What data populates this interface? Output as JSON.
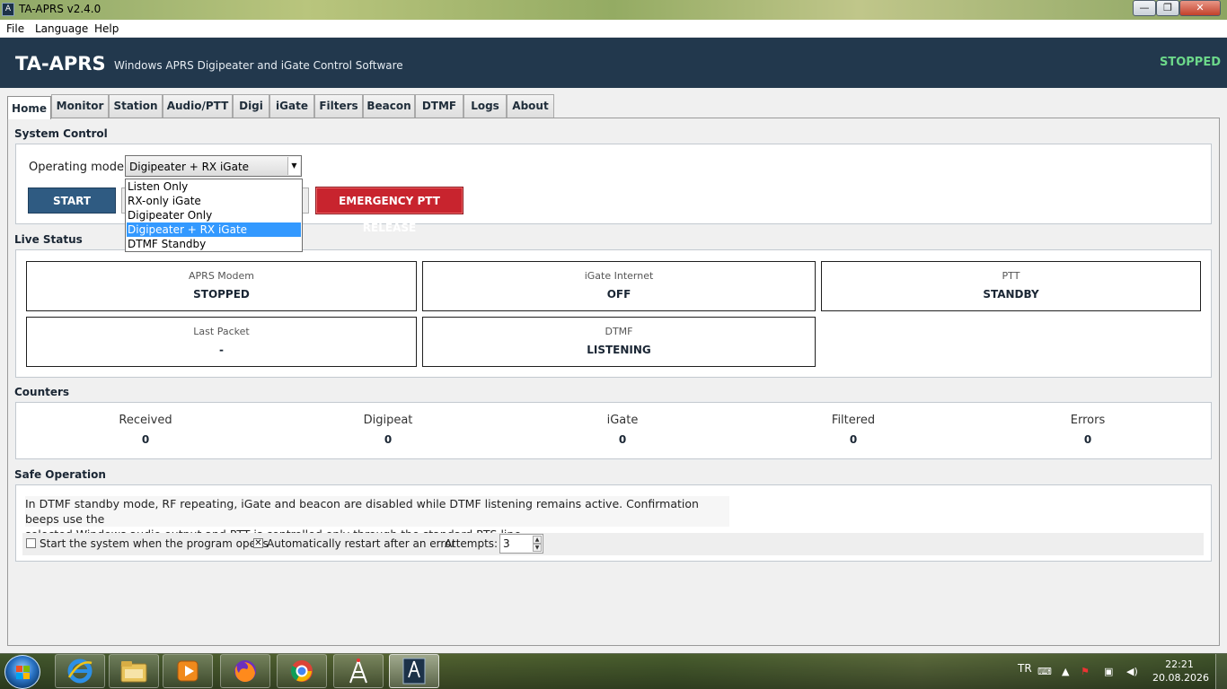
{
  "window": {
    "title": "TA-APRS v2.4.0",
    "minimize": "—",
    "maximize": "❐",
    "close": "✕"
  },
  "menu": [
    "File",
    "Language",
    "Help"
  ],
  "header": {
    "title": "TA-APRS",
    "subtitle": "Windows APRS Digipeater and iGate Control Software",
    "status": "STOPPED",
    "status_color": "#6cd88a",
    "background": "#22384d"
  },
  "tabs": [
    "Home",
    "Monitor",
    "Station",
    "Audio/PTT",
    "Digi",
    "iGate",
    "Filters",
    "Beacon",
    "DTMF",
    "Logs",
    "About"
  ],
  "active_tab": "Home",
  "system_control": {
    "title": "System Control",
    "mode_label": "Operating mode",
    "mode_value": "Digipeater + RX iGate",
    "mode_options": [
      "Listen Only",
      "RX-only iGate",
      "Digipeater Only",
      "Digipeater + RX iGate",
      "DTMF Standby"
    ],
    "start_label": "START",
    "emergency_label": "EMERGENCY PTT RELEASE",
    "start_color": "#2f5b82",
    "emergency_color": "#c8242e"
  },
  "live_status": {
    "title": "Live Status",
    "cards": [
      {
        "label": "APRS Modem",
        "value": "STOPPED"
      },
      {
        "label": "iGate Internet",
        "value": "OFF"
      },
      {
        "label": "PTT",
        "value": "STANDBY"
      },
      {
        "label": "Last Packet",
        "value": "-"
      },
      {
        "label": "DTMF",
        "value": "LISTENING"
      }
    ]
  },
  "counters": {
    "title": "Counters",
    "items": [
      {
        "label": "Received",
        "value": "0"
      },
      {
        "label": "Digipeat",
        "value": "0"
      },
      {
        "label": "iGate",
        "value": "0"
      },
      {
        "label": "Filtered",
        "value": "0"
      },
      {
        "label": "Errors",
        "value": "0"
      }
    ]
  },
  "safe_operation": {
    "title": "Safe Operation",
    "info_line1": "In DTMF standby mode, RF repeating, iGate and beacon are disabled while DTMF listening remains active. Confirmation beeps use the",
    "info_line2": "selected Windows audio output and PTT is controlled only through the standard RTS line.",
    "autostart_label": "Start the system when the program opens",
    "autostart_checked": false,
    "autorestart_label": "Automatically restart after an error",
    "autorestart_checked": true,
    "attempts_label": "Attempts:",
    "attempts_value": "3"
  },
  "taskbar": {
    "apps": [
      "internet-explorer-icon",
      "file-explorer-icon",
      "media-player-icon",
      "firefox-icon",
      "chrome-icon",
      "tower-app-icon",
      "ta-aprs-icon"
    ],
    "language": "TR",
    "time": "22:21",
    "date": "20.08.2026"
  }
}
